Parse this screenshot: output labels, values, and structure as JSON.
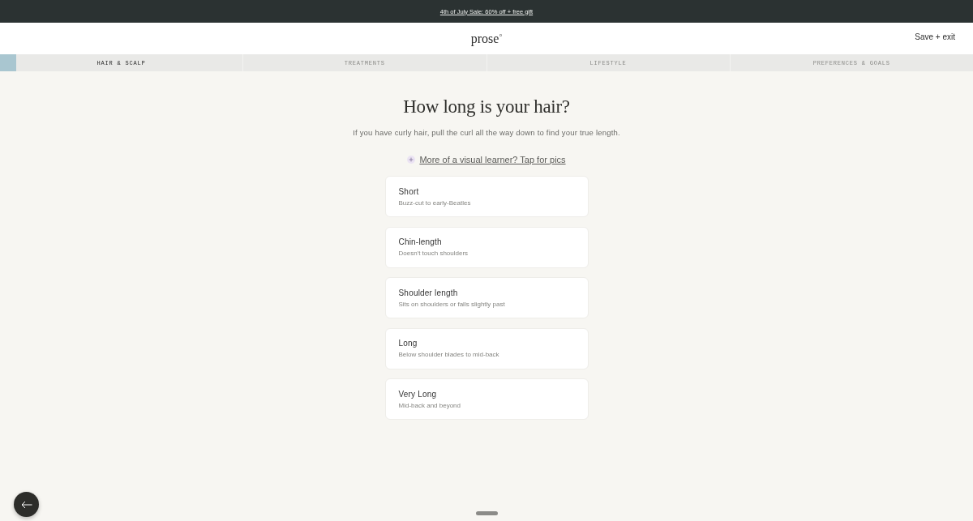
{
  "banner": {
    "text": "4th of July Sale: 60% off + free gift"
  },
  "header": {
    "logo": "prose",
    "action": "Save + exit"
  },
  "tabs": [
    {
      "label": "HAIR & SCALP",
      "selected": true,
      "level": 0.067
    },
    {
      "label": "TREATMENTS",
      "selected": false
    },
    {
      "label": "LIFESTYLE",
      "selected": false
    },
    {
      "label": "PREFERENCES & GOALS",
      "selected": false
    }
  ],
  "question": {
    "title": "How long is your hair?",
    "hint": "If you have curly hair, pull the curl all the way down to find your true length.",
    "link": "More of a visual learner? Tap for pics"
  },
  "options": [
    {
      "title": "Short",
      "description": "Buzz-cut to early-Beatles",
      "selected": false
    },
    {
      "title": "Chin-length",
      "description": "Doesn't touch shoulders",
      "selected": false
    },
    {
      "title": "Shoulder length",
      "description": "Sits on shoulders or falls slightly past",
      "selected": false
    },
    {
      "title": "Long",
      "description": "Below shoulder blades to mid-back",
      "selected": false
    },
    {
      "title": "Very Long",
      "description": "Mid-back and beyond",
      "selected": false
    }
  ]
}
